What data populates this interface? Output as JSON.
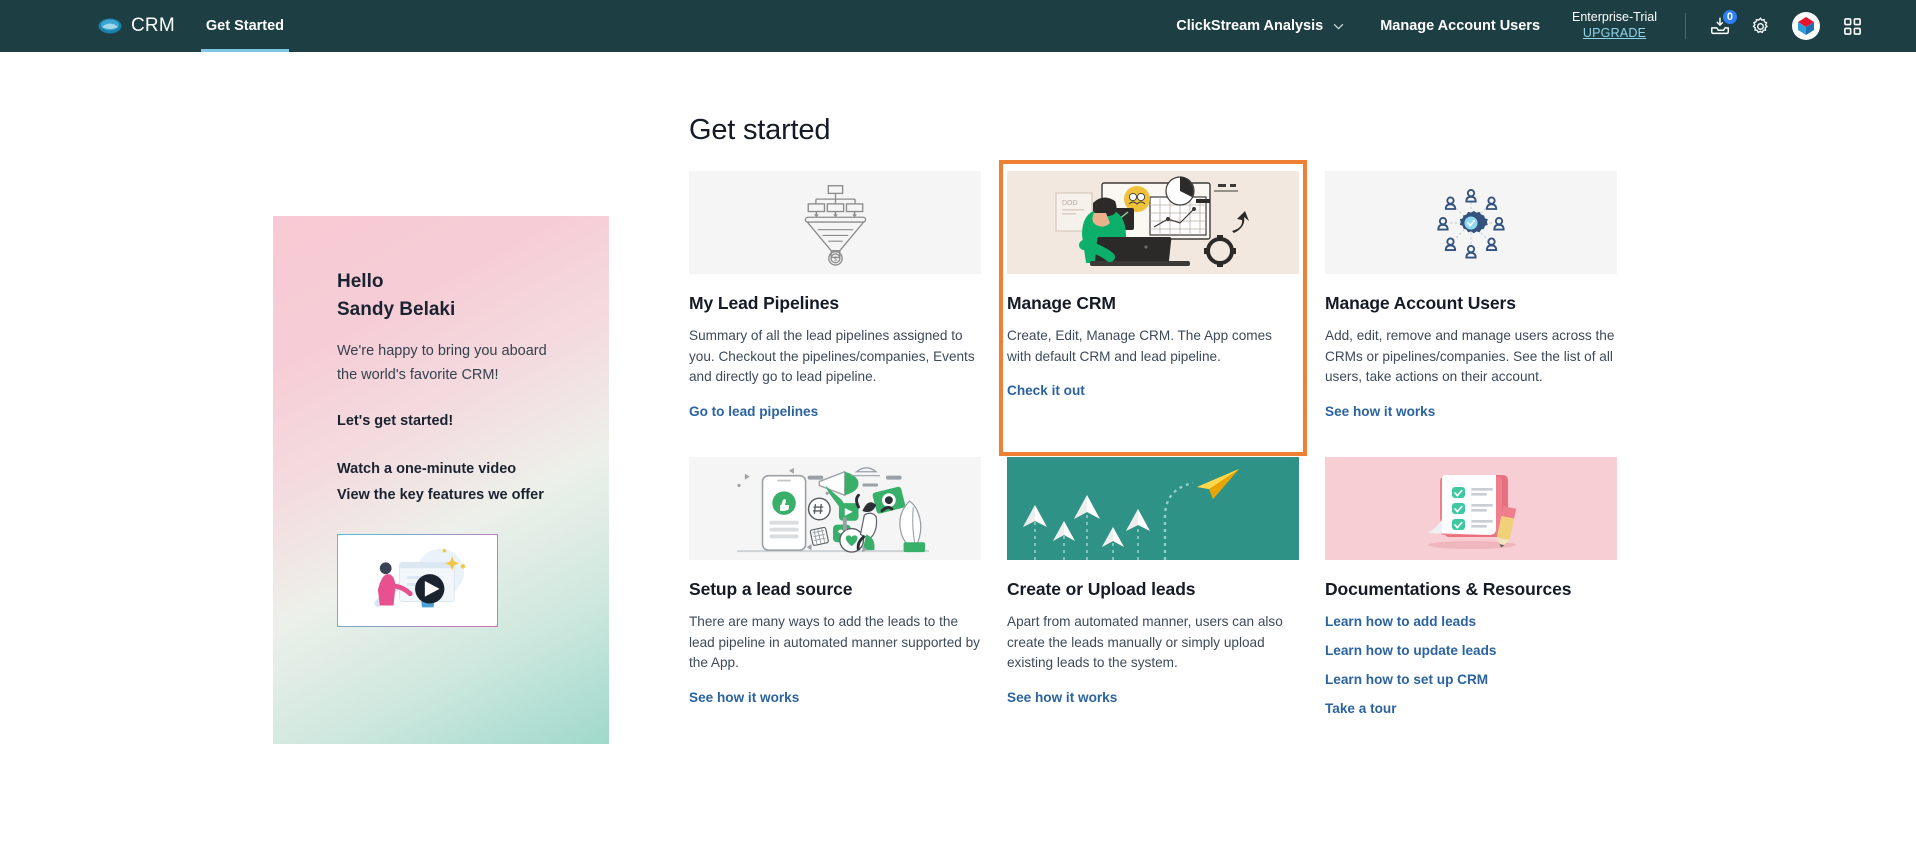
{
  "topnav": {
    "brand": {
      "logo_icon": "cloud-crm-logo-icon",
      "name": "CRM"
    },
    "tabs": [
      {
        "label": "Get Started",
        "active": true
      }
    ],
    "account_select": {
      "label": "ClickStream Analysis",
      "icon": "chevron-down-icon"
    },
    "manage_users_link": "Manage Account Users",
    "plan": {
      "name": "Enterprise-Trial",
      "upgrade": "UPGRADE"
    },
    "icons": {
      "inbox": {
        "name": "inbox-download-icon",
        "badge": "0"
      },
      "settings": {
        "name": "gear-icon"
      },
      "avatar": {
        "name": "avatar"
      },
      "apps": {
        "name": "apps-grid-icon"
      }
    }
  },
  "page": {
    "title": "Get started"
  },
  "welcome": {
    "hello": "Hello",
    "name": "Sandy Belaki",
    "body": "We're happy to bring you aboard the world's favorite CRM!",
    "cta": "Let's get started!",
    "link_video": "Watch a one-minute video",
    "link_features": "View the key features we offer",
    "video_thumb_icon": "play-button-icon"
  },
  "cards": [
    {
      "id": "my-lead-pipelines",
      "title": "My Lead Pipelines",
      "desc": "Summary of all the lead pipelines assigned to you. Checkout the pipelines/companies, Events and directly go to lead pipeline.",
      "link": "Go to lead pipelines",
      "media_icon": "sales-funnel-icon",
      "media_bg": "#f5f5f5",
      "highlighted": false
    },
    {
      "id": "manage-crm",
      "title": "Manage CRM",
      "desc": "Create, Edit, Manage CRM. The App comes with default CRM and lead pipeline.",
      "link": "Check it out",
      "media_icon": "person-at-desk-analytics-icon",
      "media_bg": "#f2e8e0",
      "highlighted": true,
      "highlight_color": "#ef8033"
    },
    {
      "id": "manage-account-users",
      "title": "Manage Account Users",
      "desc": "Add, edit, remove and manage users across the CRMs or pipelines/companies. See the list of all users, take actions on their account.",
      "link": "See how it works",
      "media_icon": "users-network-gear-icon",
      "media_bg": "#f5f5f5",
      "highlighted": false
    },
    {
      "id": "setup-a-lead-source",
      "title": "Setup a lead source",
      "desc": "There are many ways to add the leads to the lead pipeline in automated manner supported by the App.",
      "link": "See how it works",
      "media_icon": "social-media-marketing-icon",
      "media_bg": "#f5f5f5",
      "highlighted": false
    },
    {
      "id": "create-or-upload-leads",
      "title": "Create or Upload leads",
      "desc": "Apart from automated manner, users can also create the leads manually or simply upload existing leads to the system.",
      "link": "See how it works",
      "media_icon": "paper-planes-icon",
      "media_bg": "#2f9287",
      "highlighted": false
    }
  ],
  "documentations": {
    "title": "Documentations & Resources",
    "media_icon": "checklist-notepad-pencil-icon",
    "media_bg": "#f6ced3",
    "links": [
      "Learn how to add leads",
      "Learn how to update leads",
      "Learn how to set up CRM",
      "Take a tour"
    ]
  },
  "colors": {
    "nav_bg": "#1d3f44",
    "accent_link": "#2b63a0",
    "highlight": "#ef8033",
    "badge": "#2d7ff9",
    "tab_underline": "#7fc7e0"
  }
}
